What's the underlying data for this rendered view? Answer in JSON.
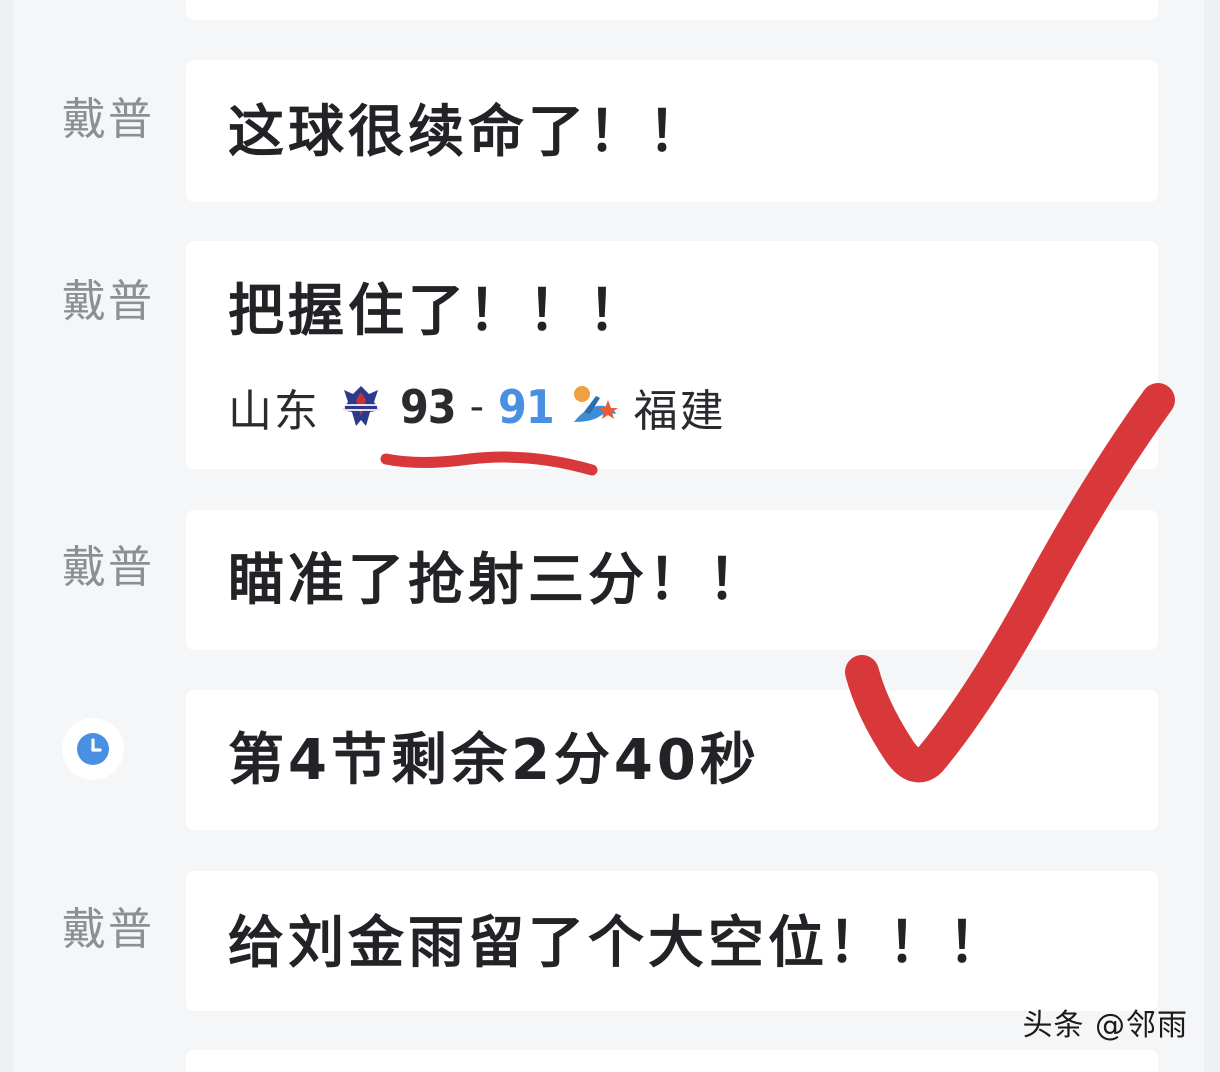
{
  "feed": {
    "items": [
      {
        "speaker": "戴普",
        "text": "这球很续命了！！"
      },
      {
        "speaker": "戴普",
        "text": "把握住了！！！",
        "score": {
          "home_team": "山东",
          "home_score": "93",
          "separator": "-",
          "away_score": "91",
          "away_team": "福建"
        }
      },
      {
        "speaker": "戴普",
        "text": "瞄准了抢射三分！！"
      },
      {
        "icon": "clock-icon",
        "text": "第4节剩余2分40秒"
      },
      {
        "speaker": "戴普",
        "text": "给刘金雨留了个大空位！！！"
      }
    ]
  },
  "watermark": "头条 @邻雨",
  "colors": {
    "background": "#f5f6f8",
    "card": "#ffffff",
    "speaker": "#8c8f94",
    "message": "#222326",
    "away_score": "#4a90e2",
    "clock": "#4a90e2",
    "annotation_red": "#d9383a"
  },
  "annotations": [
    "red-underline",
    "red-checkmark"
  ]
}
